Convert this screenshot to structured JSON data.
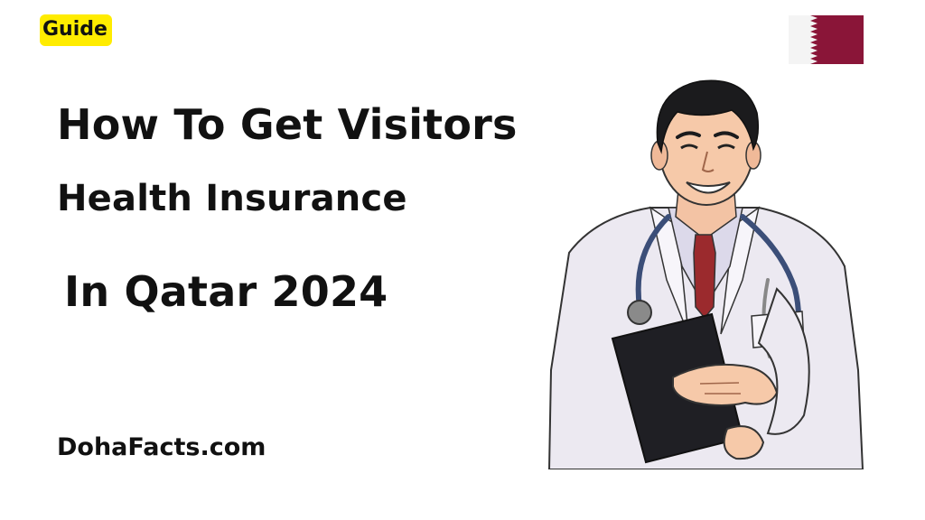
{
  "badge": {
    "label": "Guide",
    "color": "#ffec00"
  },
  "headline": {
    "line1": "How To Get Visitors",
    "line2": "Health Insurance",
    "line3": "In Qatar 2024"
  },
  "site": {
    "label": "DohaFacts.com"
  },
  "flag": {
    "icon": "qatar-flag-icon",
    "maroon": "#8a1538",
    "white": "#ffffff"
  },
  "illustration": {
    "icon": "doctor-with-stethoscope-icon"
  }
}
